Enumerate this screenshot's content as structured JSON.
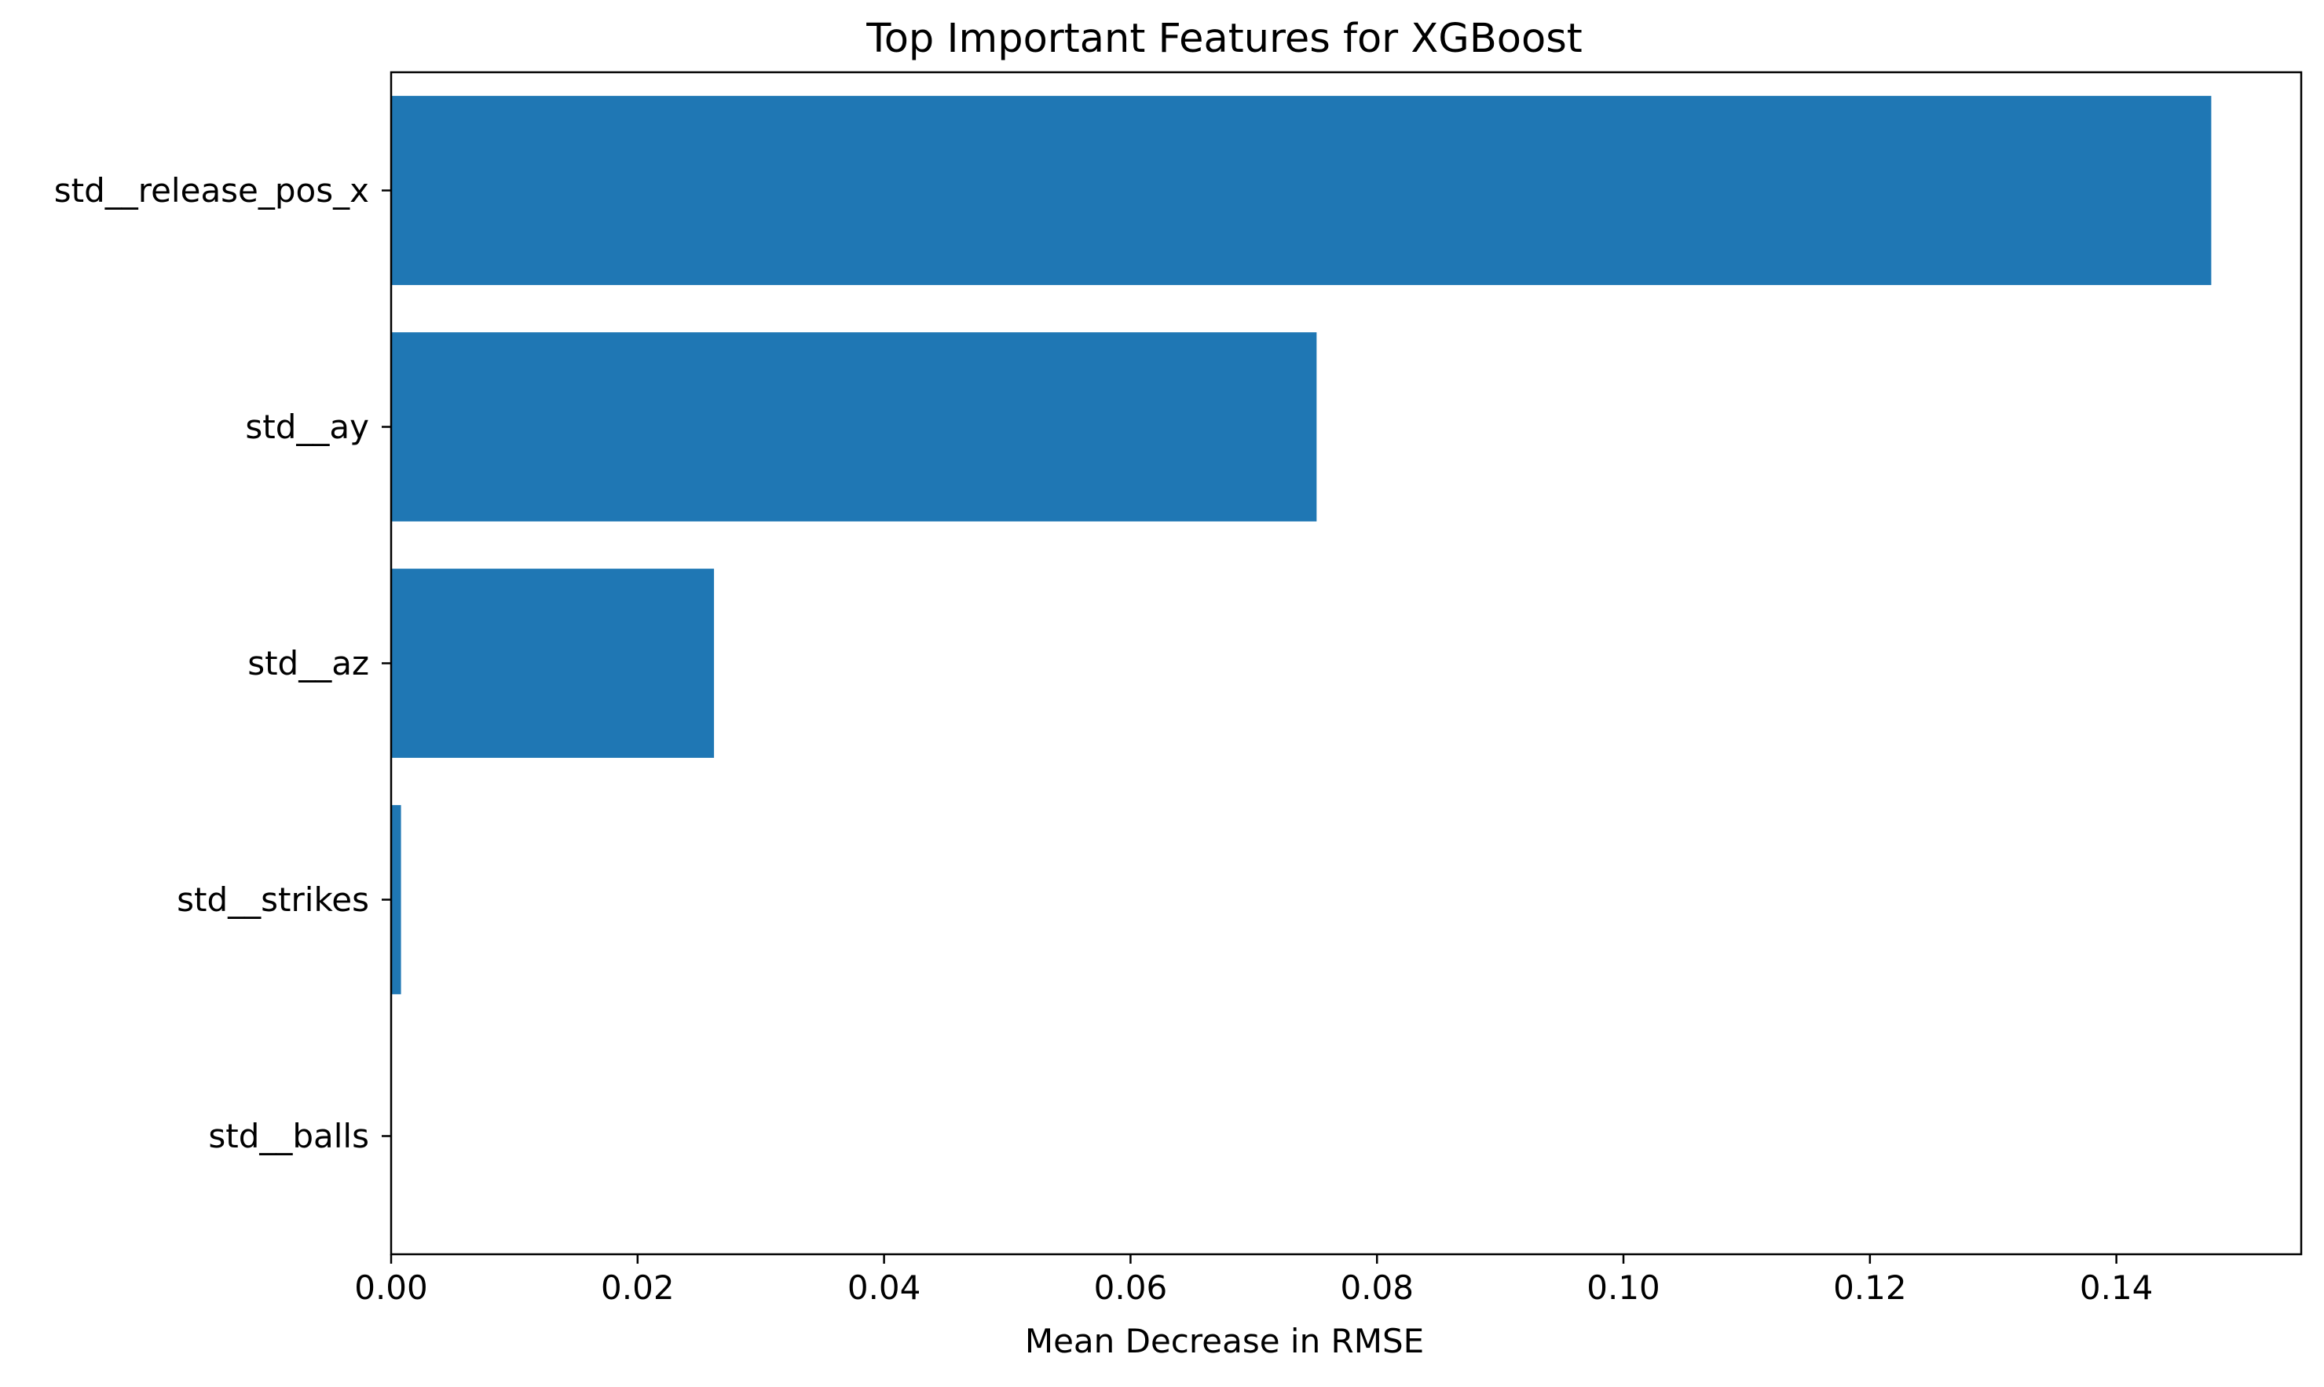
{
  "chart_data": {
    "type": "bar",
    "orientation": "horizontal",
    "title": "Top Important Features for XGBoost",
    "xlabel": "Mean Decrease in RMSE",
    "ylabel": "",
    "categories": [
      "std__release_pos_x",
      "std__ay",
      "std__az",
      "std__strikes",
      "std__balls"
    ],
    "values": [
      0.1477,
      0.0751,
      0.0262,
      0.0008,
      0.0
    ],
    "xlim": [
      0.0,
      0.155
    ],
    "xticks": [
      "0.00",
      "0.02",
      "0.04",
      "0.06",
      "0.08",
      "0.10",
      "0.12",
      "0.14"
    ],
    "xtick_values": [
      0.0,
      0.02,
      0.04,
      0.06,
      0.08,
      0.1,
      0.12,
      0.14
    ],
    "grid": false,
    "legend": "none",
    "bar_color": "#1f77b4"
  }
}
